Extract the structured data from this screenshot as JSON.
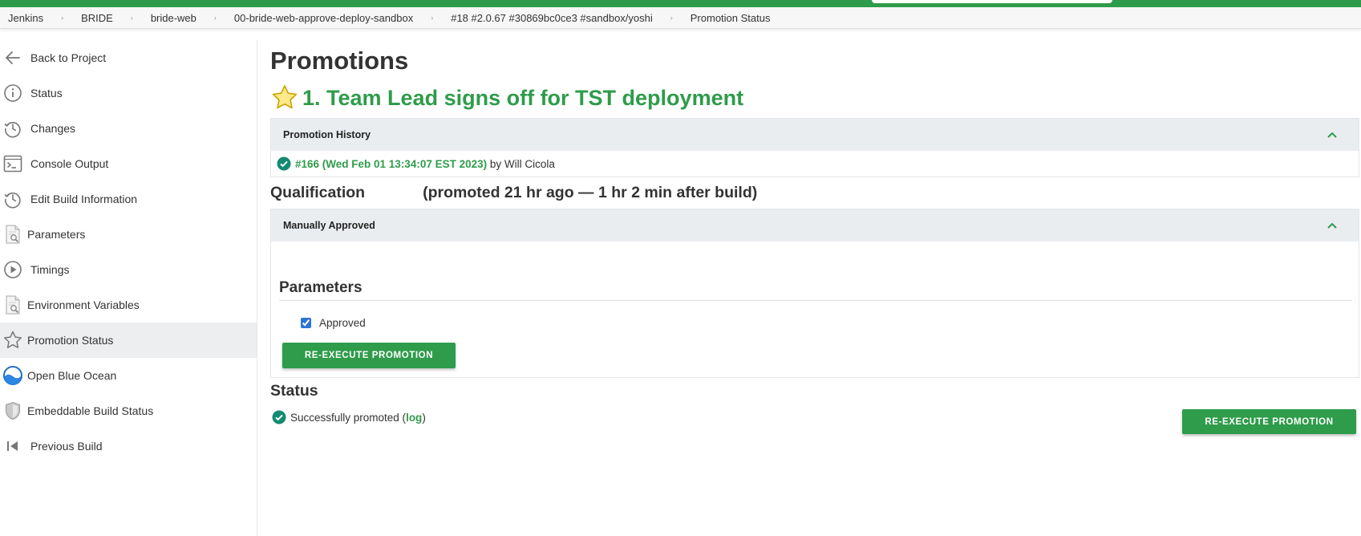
{
  "breadcrumbs": [
    {
      "label": "Jenkins"
    },
    {
      "label": "BRIDE"
    },
    {
      "label": "bride-web"
    },
    {
      "label": "00-bride-web-approve-deploy-sandbox"
    },
    {
      "label": "#18 #2.0.67 #30869bc0ce3 #sandbox/yoshi"
    },
    {
      "label": "Promotion Status"
    }
  ],
  "sidebar": {
    "items": [
      {
        "label": "Back to Project",
        "icon": "arrow-left-icon"
      },
      {
        "label": "Status",
        "icon": "info-icon"
      },
      {
        "label": "Changes",
        "icon": "history-icon"
      },
      {
        "label": "Console Output",
        "icon": "terminal-icon"
      },
      {
        "label": "Edit Build Information",
        "icon": "history-icon"
      },
      {
        "label": "Parameters",
        "icon": "document-search-icon"
      },
      {
        "label": "Timings",
        "icon": "play-circle-icon"
      },
      {
        "label": "Environment Variables",
        "icon": "document-search-icon"
      },
      {
        "label": "Promotion Status",
        "icon": "star-icon",
        "active": true
      },
      {
        "label": "Open Blue Ocean",
        "icon": "blue-ocean-icon"
      },
      {
        "label": "Embeddable Build Status",
        "icon": "shield-icon"
      },
      {
        "label": "Previous Build",
        "icon": "previous-icon"
      }
    ]
  },
  "main": {
    "title": "Promotions",
    "promotion_name": "1. Team Lead signs off for TST deployment",
    "history": {
      "header": "Promotion History",
      "entry_link": "#166 (Wed Feb 01 13:34:07 EST 2023)",
      "entry_by": " by Will Cicola"
    },
    "qualification": {
      "label": "Qualification",
      "detail": "(promoted 21 hr ago — 1 hr 2 min after build)"
    },
    "manual": {
      "header": "Manually Approved",
      "params_title": "Parameters",
      "approved_label": "Approved",
      "approved_checked": true,
      "reexecute_label": "RE-EXECUTE PROMOTION"
    },
    "status": {
      "title": "Status",
      "text_before": "Successfully promoted (",
      "log_link": "log",
      "text_after": ")",
      "reexecute_label": "RE-EXECUTE PROMOTION"
    }
  },
  "colors": {
    "accent_green": "#2e9c4a",
    "panel_header_bg": "#eaedf0",
    "active_item_bg": "#eceef0",
    "check_teal": "#138a72"
  }
}
